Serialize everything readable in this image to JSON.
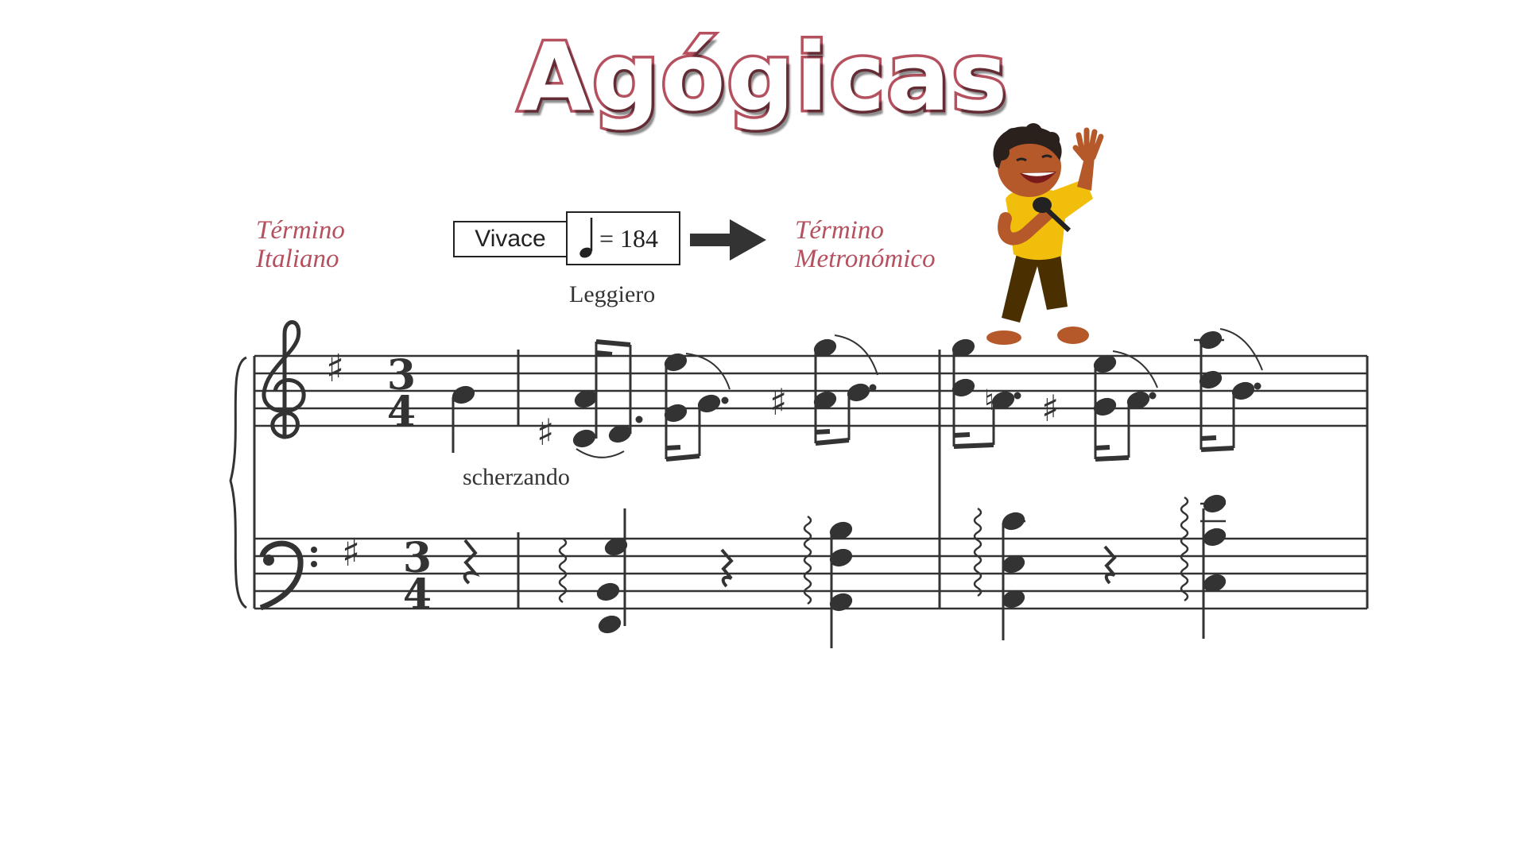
{
  "title": "Agógicas",
  "term_italian": {
    "line1": "Término",
    "line2": "Italiano"
  },
  "term_metronomic": {
    "line1": "Término",
    "line2": "Metronómico"
  },
  "tempo": {
    "italian": "Vivace",
    "metronome_value": "= 184"
  },
  "markings": {
    "leggiero": "Leggiero",
    "scherzando": "scherzando"
  },
  "score": {
    "time_signature_top": "3",
    "time_signature_bottom": "4",
    "key_signature": "one sharp"
  },
  "colors": {
    "accent": "#b5505f",
    "ink": "#333333",
    "shirt": "#f1be0b",
    "pants": "#4a3000",
    "skin": "#b5592b"
  },
  "icons": {
    "arrow": "right-arrow-icon",
    "quarter_note": "quarter-note-icon"
  }
}
